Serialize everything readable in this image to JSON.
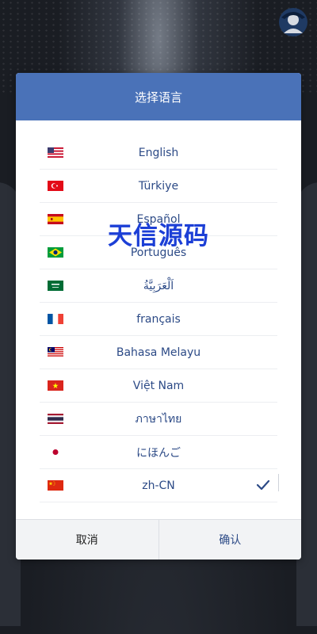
{
  "dialog": {
    "title": "选择语言",
    "languages": [
      {
        "label": "English",
        "flag": "us-flag-icon"
      },
      {
        "label": "Türkiye",
        "flag": "turkey-flag-icon"
      },
      {
        "label": "Español",
        "flag": "spain-flag-icon"
      },
      {
        "label": "Português",
        "flag": "brazil-flag-icon"
      },
      {
        "label": "اَلْعَرَبِيَّةُ",
        "flag": "saudi-flag-icon"
      },
      {
        "label": "français",
        "flag": "france-flag-icon"
      },
      {
        "label": "Bahasa Melayu",
        "flag": "malaysia-flag-icon"
      },
      {
        "label": "Việt Nam",
        "flag": "vietnam-flag-icon"
      },
      {
        "label": "ภาษาไทย",
        "flag": "thailand-flag-icon"
      },
      {
        "label": "にほんご",
        "flag": "japan-flag-icon"
      },
      {
        "label": "zh-CN",
        "flag": "china-flag-icon",
        "selected": true
      }
    ],
    "cancel_label": "取消",
    "confirm_label": "确认"
  },
  "watermark": "天信源码",
  "colors": {
    "header": "#4a72b8",
    "text": "#2c4a86",
    "watermark": "#1c3fd6"
  }
}
